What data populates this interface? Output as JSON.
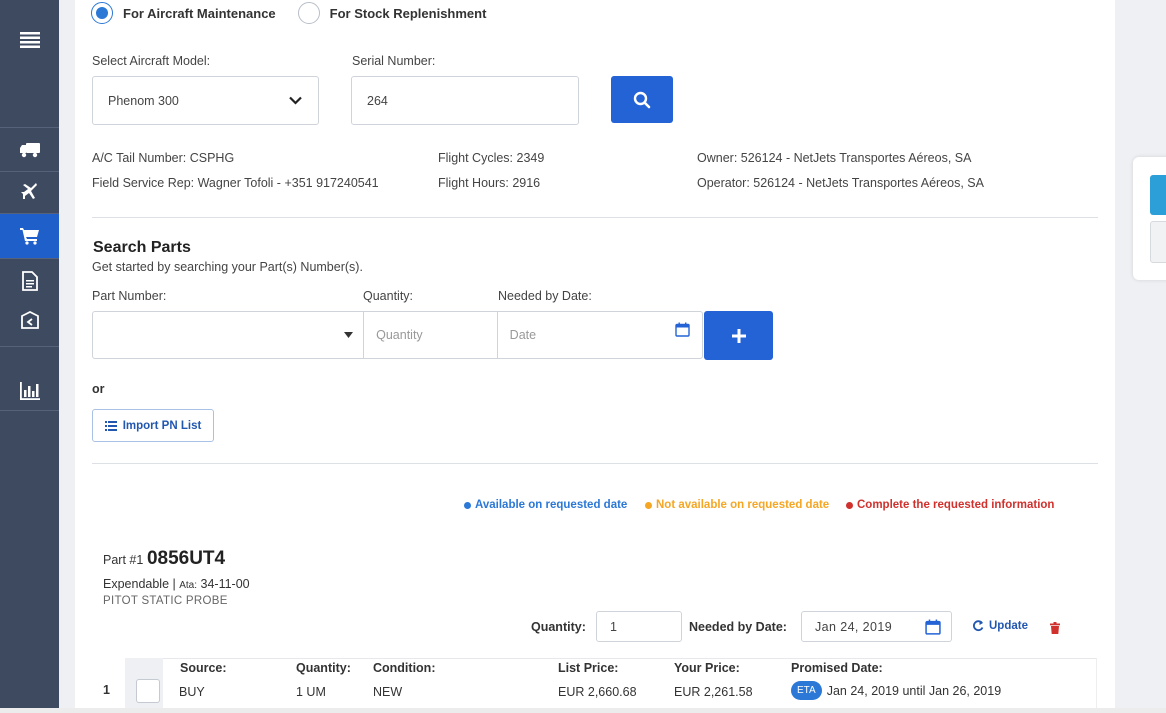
{
  "mode": {
    "options": [
      {
        "label": "For Aircraft Maintenance",
        "checked": true
      },
      {
        "label": "For Stock Replenishment",
        "checked": false
      }
    ]
  },
  "aircraft": {
    "model_label": "Select Aircraft Model:",
    "model_value": "Phenom 300",
    "serial_label": "Serial Number:",
    "serial_value": "264"
  },
  "info": {
    "tail": "A/C Tail Number: CSPHG",
    "rep": "Field Service Rep: Wagner Tofoli - +351 917240541",
    "cycles": "Flight Cycles: 2349",
    "hours": "Flight Hours: 2916",
    "owner": "Owner: 526124 - NetJets Transportes Aéreos, SA",
    "operator": "Operator: 526124 - NetJets Transportes Aéreos, SA"
  },
  "search": {
    "title": "Search Parts",
    "subtitle": "Get started by searching your Part(s) Number(s).",
    "part_label": "Part Number:",
    "qty_label": "Quantity:",
    "date_label": "Needed by Date:",
    "qty_placeholder": "Quantity",
    "date_placeholder": "Date",
    "or_text": "or",
    "import_label": "Import PN List"
  },
  "legend": [
    {
      "text": "Available on requested date",
      "color": "#2b78d6"
    },
    {
      "text": "Not available on requested date",
      "color": "#f5a623"
    },
    {
      "text": "Complete the requested information",
      "color": "#d0312d"
    }
  ],
  "part": {
    "prefix": "Part #1",
    "number": "0856UT4",
    "type": "Expendable |",
    "ata_label": "Ata:",
    "ata_value": "34-11-00",
    "description": "PITOT STATIC PROBE",
    "qty_label": "Quantity:",
    "qty_value": "1",
    "date_label": "Needed by Date:",
    "date_value": "Jan 24, 2019",
    "update_label": "Update"
  },
  "table": {
    "headers": {
      "source": "Source:",
      "quantity": "Quantity:",
      "condition": "Condition:",
      "list_price": "List Price:",
      "your_price": "Your Price:",
      "promised": "Promised Date:"
    },
    "rows": [
      {
        "index": "1",
        "source": "BUY",
        "quantity": "1 UM",
        "condition": "NEW",
        "list_price": "EUR 2,660.68",
        "your_price": "EUR 2,261.58",
        "badge": "ETA",
        "promised": "Jan 24, 2019 until Jan 26, 2019"
      }
    ]
  },
  "colors": {
    "sidebar": "#3e4a5f",
    "accent": "#2463d6",
    "active_nav": "#1f5fc9"
  }
}
